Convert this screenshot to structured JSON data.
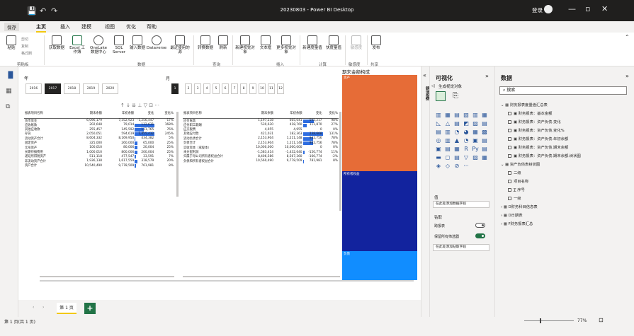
{
  "window": {
    "title": "20230803 - Power BI Desktop",
    "login": "登录",
    "quick_access": [
      "💾",
      "↶",
      "↷"
    ],
    "controls": [
      "—",
      "▫",
      "✕"
    ]
  },
  "menu": {
    "save": "保存",
    "items": [
      "主页",
      "插入",
      "建模",
      "视图",
      "优化",
      "帮助"
    ]
  },
  "ribbon": {
    "clipboard": {
      "paste": "粘贴",
      "cut": "剪切",
      "copy": "复制",
      "format_painter": "格式刷",
      "group": "剪贴板"
    },
    "data_buttons": [
      "获取数据",
      "Excel 工作簿",
      "OneLake 数据中心",
      "SQL Server",
      "输入数据",
      "Dataverse",
      "最近使用的源"
    ],
    "data_group": "数据",
    "query_buttons": [
      "转换数据",
      "刷新"
    ],
    "query_group": "查询",
    "insert_buttons": [
      "新建视觉对象",
      "文本框",
      "更多视觉对象"
    ],
    "insert_group": "插入",
    "calc_buttons": [
      "新建度量值",
      "快度量值"
    ],
    "calc_group": "计算",
    "sens_button": "敏感度",
    "sens_group": "敏感度",
    "share_button": "发布",
    "share_group": "共享"
  },
  "canvas": {
    "year_label": "年",
    "month_label": "月",
    "years": [
      "2016",
      "2017",
      "2018",
      "2019",
      "2020"
    ],
    "selected_year": "2017",
    "months": [
      "1",
      "2",
      "3",
      "4",
      "5",
      "6",
      "7",
      "8",
      "9",
      "10",
      "11",
      "12"
    ],
    "selected_month": "1",
    "visual_tools": "↑  ↓  ⇊  ⊥  ▽  ⊡  ···",
    "treemap_title": "期末金额构成",
    "treemap": [
      {
        "label": "资产",
        "color": "#e66c37",
        "share": 0.47
      },
      {
        "label": "所有者权益",
        "color": "#12239e",
        "share": 0.39
      },
      {
        "label": "负债",
        "color": "#118dff",
        "share": 0.14
      }
    ],
    "assets_table": {
      "headers": [
        "报表项目名称",
        "期末余额",
        "年初余额",
        "变化",
        "变化%"
      ],
      "rows": [
        [
          "货币资金",
          "6,096,179",
          "7,352,923",
          "-1,256,447",
          "-17%",
          0.0
        ],
        [
          "应收账款",
          "202,648",
          "79,014",
          "132,631",
          "168%",
          1.0
        ],
        [
          "其他应收款",
          "255,457",
          "145,592",
          "111,765",
          "76%",
          0.45
        ],
        [
          "存货",
          "2,050,051",
          "594,619",
          "1,455,432",
          "245%",
          1.0
        ],
        [
          "流动资产合计",
          "8,604,332",
          "8,169,950",
          "434,382",
          "5%",
          0.03
        ],
        [
          "固定资产",
          "325,000",
          "260,000",
          "65,000",
          "25%",
          0.15
        ],
        [
          "无形资产",
          "100,010",
          "80,006",
          "20,004",
          "25%",
          0.15
        ],
        [
          "长期待摊费用",
          "1,000,010",
          "800,006",
          "200,004",
          "25%",
          0.15
        ],
        [
          "递延所得税资产",
          "511,118",
          "477,547",
          "33,591",
          "7%",
          0.05
        ],
        [
          "非流动资产合计",
          "1,936,138",
          "1,617,559",
          "318,579",
          "20%",
          0.12
        ],
        [
          "资产合计",
          "10,540,490",
          "9,778,509",
          "761,981",
          "8%",
          0.06
        ]
      ]
    },
    "liab_table": {
      "headers": [
        "报表项目名称",
        "期末余额",
        "年初余额",
        "变化",
        "变化%"
      ],
      "rows": [
        [
          "应付账款",
          "1,197,238",
          "605,041",
          "592,217",
          "98%",
          0.55
        ],
        [
          "应付职工薪酬",
          "530,630",
          "418,760",
          "111,870",
          "27%",
          0.18
        ],
        [
          "应交税费",
          "4,955",
          "4,955",
          "0",
          "0%",
          0.0
        ],
        [
          "其他应付款",
          "421,031",
          "182,363",
          "238,668",
          "131%",
          1.0
        ],
        [
          "流动负债合计",
          "2,153,904",
          "1,211,148",
          "942,756",
          "78%",
          0.5
        ],
        [
          "负债合计",
          "2,153,904",
          "1,211,148",
          "942,756",
          "78%",
          0.5
        ],
        [
          "实收资本（或股本）",
          "10,000,000",
          "10,000,000",
          "0",
          "0%",
          0.0
        ],
        [
          "未分配利润",
          "-1,583,414",
          "-1,432,640",
          "-150,774",
          "11%",
          0.07
        ],
        [
          "归属于母公司所有者权益合计",
          "8,406,586",
          "8,567,360",
          "-160,774",
          "-2%",
          0.0
        ],
        [
          "负债和所有者权益合计",
          "10,560,490",
          "9,778,509",
          "781,981",
          "8%",
          0.06
        ]
      ]
    }
  },
  "pages": {
    "tab": "第 1 页",
    "nav_prev": "‹",
    "nav_next": "›",
    "add": "+"
  },
  "status": {
    "page": "第 1 页(共 1 页)",
    "zoom": "77%"
  },
  "filters": {
    "label": "筛选器"
  },
  "viz": {
    "title": "可视化",
    "build_label": "生成视觉对象",
    "icons": [
      "▥",
      "▦",
      "▤",
      "▧",
      "▥",
      "▦",
      "◺",
      "△",
      "▤",
      "◩",
      "▨",
      "▤",
      "▤",
      "▥",
      "◔",
      "◕",
      "▦",
      "▩",
      "◎",
      "▥",
      "▲",
      "◔",
      "▣",
      "▤",
      "▣",
      "▤",
      "▦",
      "R",
      "Py",
      "▤",
      "▬",
      "◻",
      "▤",
      "▽",
      "▨",
      "▦",
      "◈",
      "◇",
      "⊘",
      "···"
    ],
    "values_label": "值",
    "values_placeholder": "在此处添加数据字段",
    "drill_label": "钻取",
    "cross_report": "跨报表",
    "cross_report_state": "关",
    "keep_filters": "保留所有筛选器",
    "keep_filters_state": "开",
    "drill_placeholder": "在此处添加钻取字段"
  },
  "data": {
    "title": "数据",
    "search_placeholder": "搜索",
    "tree": [
      {
        "level": 0,
        "kind": "table",
        "label": "财务报表度量值汇总表",
        "expanded": true
      },
      {
        "level": 1,
        "kind": "measure",
        "label": "财务报表：基本金额"
      },
      {
        "level": 1,
        "kind": "measure",
        "label": "财务报表：资产负债.变化"
      },
      {
        "level": 1,
        "kind": "measure",
        "label": "财务报表：资产负债.变化%"
      },
      {
        "level": 1,
        "kind": "measure",
        "label": "财务报表：资产负债.年初余额"
      },
      {
        "level": 1,
        "kind": "measure",
        "label": "财务报表：资产负债.期末余额"
      },
      {
        "level": 1,
        "kind": "measure",
        "label": "财务报表：资产负债.期末余额.树状图"
      },
      {
        "level": 0,
        "kind": "table",
        "label": "资产负债表树状图",
        "expanded": true
      },
      {
        "level": 1,
        "kind": "field",
        "label": "二级"
      },
      {
        "level": 1,
        "kind": "field",
        "label": "项目名称"
      },
      {
        "level": 1,
        "kind": "field",
        "label": "∑ 序号"
      },
      {
        "level": 1,
        "kind": "field",
        "label": "一级"
      },
      {
        "level": 0,
        "kind": "table",
        "label": "D财务科目信息表",
        "expanded": false
      },
      {
        "level": 0,
        "kind": "table",
        "label": "D日期表",
        "expanded": false
      },
      {
        "level": 0,
        "kind": "table",
        "label": "F财务报表汇总",
        "expanded": false
      }
    ]
  }
}
